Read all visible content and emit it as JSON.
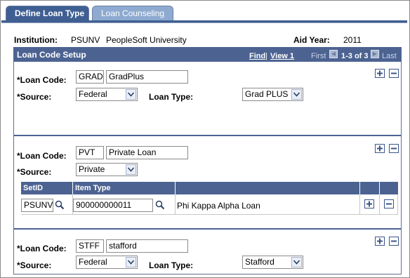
{
  "tabs": [
    {
      "label": "Define Loan Type",
      "active": true
    },
    {
      "label": "Loan Counseling",
      "active": false
    }
  ],
  "header": {
    "institution_label": "Institution:",
    "institution_code": "PSUNV",
    "institution_name": "PeopleSoft University",
    "aid_year_label": "Aid Year:",
    "aid_year": "2011"
  },
  "grid": {
    "title": "Loan Code Setup",
    "find": "Find",
    "view1": "View 1",
    "first": "First",
    "range": "1-3 of 3",
    "last": "Last"
  },
  "labels": {
    "loan_code": "*Loan Code:",
    "source": "*Source:",
    "loan_type": "Loan Type:"
  },
  "rows": [
    {
      "code": "GRAD",
      "desc": "GradPlus",
      "source": "Federal",
      "loan_type": "Grad PLUS"
    },
    {
      "code": "PVT",
      "desc": "Private Loan",
      "source": "Private"
    },
    {
      "code": "STFF",
      "desc": "stafford",
      "source": "Federal",
      "loan_type": "Stafford"
    }
  ],
  "subgrid": {
    "col_setid": "SetID",
    "col_item_type": "Item Type",
    "setid": "PSUNV",
    "item_type": "900000000011",
    "item_desc": "Phi Kappa Alpha Loan"
  },
  "colors": {
    "header_blue": "#4c6392",
    "tab_active": "#3f5f93",
    "tab_inactive": "#8eaad0"
  }
}
